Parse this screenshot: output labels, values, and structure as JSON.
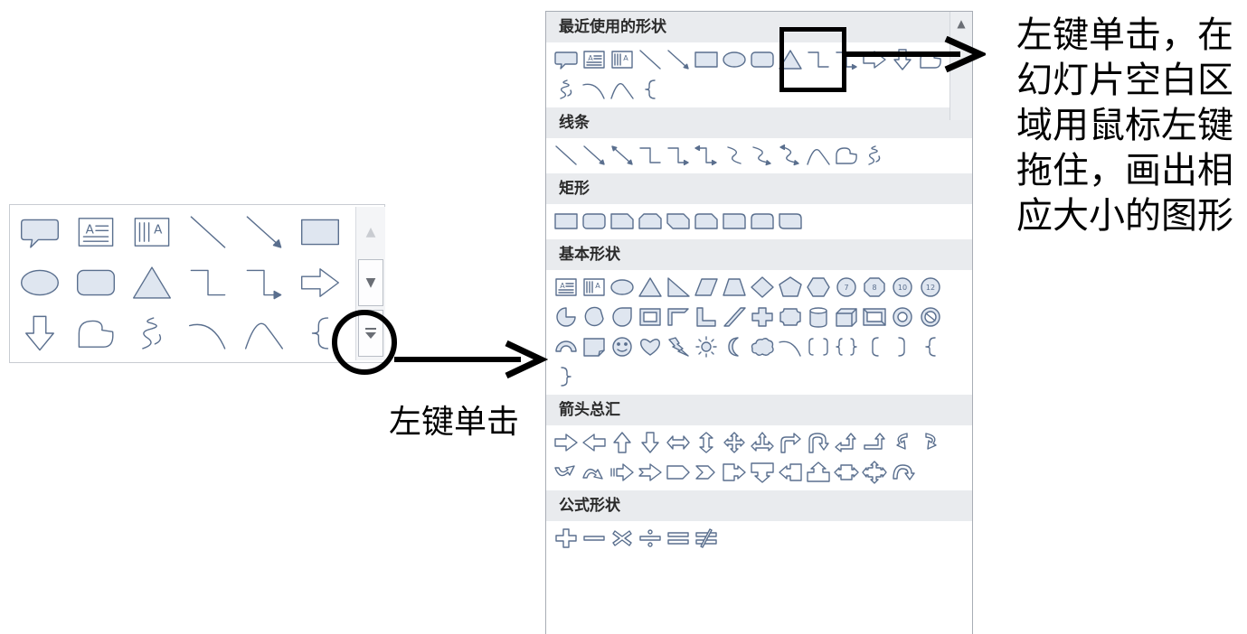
{
  "gallery": {
    "shapes": [
      "callout-icon",
      "text-box-icon",
      "vertical-text-box-icon",
      "line-icon",
      "arrow-line-icon",
      "rectangle-icon",
      "oval-icon",
      "rounded-rectangle-icon",
      "triangle-icon",
      "elbow-connector-icon",
      "elbow-arrow-connector-icon",
      "right-arrow-icon",
      "down-arrow-icon",
      "freeform-icon",
      "scribble-icon",
      "arc-icon",
      "curve-icon",
      "left-brace-icon"
    ],
    "scroll_up_icon": "chevron-up-icon",
    "scroll_down_icon": "chevron-down-icon",
    "more_icon": "more-dropdown-icon"
  },
  "dropdown": {
    "sections": [
      {
        "title": "最近使用的形状",
        "icons": [
          "callout-icon",
          "text-box-icon",
          "vertical-text-box-icon",
          "line-icon",
          "arrow-line-icon",
          "rectangle-icon",
          "oval-icon",
          "rounded-rectangle-icon",
          "triangle-icon",
          "elbow-connector-icon",
          "elbow-arrow-connector-icon",
          "right-arrow-icon",
          "down-arrow-icon",
          "freeform-icon",
          "scribble-icon",
          "arc-icon",
          "curve-icon",
          "left-brace-icon"
        ]
      },
      {
        "title": "线条",
        "icons": [
          "line-icon",
          "arrow-line-icon",
          "double-arrow-line-icon",
          "elbow-connector-icon",
          "elbow-arrow-connector-icon",
          "elbow-double-arrow-icon",
          "curved-connector-icon",
          "curved-arrow-connector-icon",
          "curved-double-arrow-icon",
          "curve-icon",
          "freeform-icon",
          "scribble-icon"
        ]
      },
      {
        "title": "矩形",
        "icons": [
          "rectangle-icon",
          "rounded-rectangle-icon",
          "snip-corner-rectangle-icon",
          "snip-same-side-rectangle-icon",
          "snip-diagonal-rectangle-icon",
          "snip-round-rectangle-icon",
          "round-corner-rectangle-icon",
          "round-same-side-rectangle-icon",
          "round-diagonal-rectangle-icon"
        ]
      },
      {
        "title": "基本形状",
        "icons": [
          "text-box-icon",
          "vertical-text-box-icon",
          "oval-icon",
          "triangle-icon",
          "right-triangle-icon",
          "parallelogram-icon",
          "trapezoid-icon",
          "diamond-icon",
          "pentagon-icon",
          "hexagon-icon",
          "heptagon-icon",
          "octagon-icon",
          "decagon-icon",
          "dodecagon-icon",
          "pie-icon",
          "chord-icon",
          "teardrop-icon",
          "frame-icon",
          "half-frame-icon",
          "l-shape-icon",
          "diagonal-stripe-icon",
          "cross-icon",
          "plaque-icon",
          "can-icon",
          "cube-icon",
          "bevel-icon",
          "donut-icon",
          "no-symbol-icon",
          "block-arc-icon",
          "folded-corner-icon",
          "smiley-face-icon",
          "heart-icon",
          "lightning-bolt-icon",
          "sun-icon",
          "moon-icon",
          "cloud-icon",
          "arc-icon",
          "double-bracket-icon",
          "double-brace-icon",
          "left-bracket-icon",
          "right-bracket-icon",
          "left-brace-icon",
          "right-brace-icon"
        ]
      },
      {
        "title": "箭头总汇",
        "icons": [
          "right-arrow-icon",
          "left-arrow-icon",
          "up-arrow-icon",
          "down-arrow-icon",
          "left-right-arrow-icon",
          "up-down-arrow-icon",
          "quad-arrow-icon",
          "left-right-up-arrow-icon",
          "bent-arrow-icon",
          "u-turn-arrow-icon",
          "left-up-arrow-icon",
          "bent-up-arrow-icon",
          "curved-right-arrow-icon",
          "curved-left-arrow-icon",
          "curved-up-arrow-icon",
          "curved-down-arrow-icon",
          "striped-right-arrow-icon",
          "notched-right-arrow-icon",
          "pentagon-arrow-icon",
          "chevron-icon",
          "right-arrow-callout-icon",
          "down-arrow-callout-icon",
          "left-arrow-callout-icon",
          "up-arrow-callout-icon",
          "left-right-arrow-callout-icon",
          "quad-arrow-callout-icon",
          "circular-arrow-icon"
        ]
      },
      {
        "title": "公式形状",
        "icons": [
          "plus-icon",
          "minus-icon",
          "multiply-icon",
          "division-icon",
          "equal-icon",
          "not-equal-icon"
        ]
      }
    ],
    "scroll_up_icon": "chevron-up-icon"
  },
  "annotations": {
    "left_click_label": "左键单击",
    "instruction_lines": [
      "左键单击，在",
      "幻灯片空白区",
      "域用鼠标左键",
      "拖住，画出相",
      "应大小的图形"
    ]
  }
}
